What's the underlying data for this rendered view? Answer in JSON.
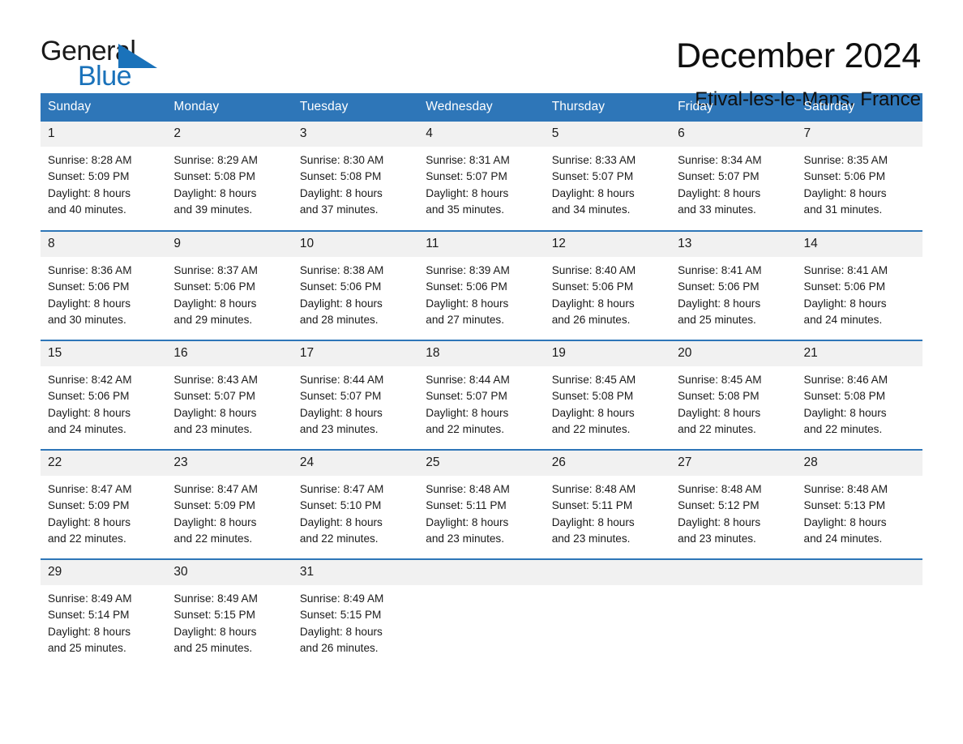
{
  "brand": {
    "name_part1": "General",
    "name_part2": "Blue",
    "accent_color": "#1a72ba"
  },
  "header": {
    "title": "December 2024",
    "location": "Etival-les-le-Mans, France"
  },
  "theme": {
    "header_blue": "#2e76b8",
    "day_band_gray": "#f1f1f1",
    "text_color": "#1a1a1a"
  },
  "calendar": {
    "weekday_headers": [
      "Sunday",
      "Monday",
      "Tuesday",
      "Wednesday",
      "Thursday",
      "Friday",
      "Saturday"
    ],
    "weeks": [
      [
        {
          "day": "1",
          "info": "Sunrise: 8:28 AM\nSunset: 5:09 PM\nDaylight: 8 hours\nand 40 minutes."
        },
        {
          "day": "2",
          "info": "Sunrise: 8:29 AM\nSunset: 5:08 PM\nDaylight: 8 hours\nand 39 minutes."
        },
        {
          "day": "3",
          "info": "Sunrise: 8:30 AM\nSunset: 5:08 PM\nDaylight: 8 hours\nand 37 minutes."
        },
        {
          "day": "4",
          "info": "Sunrise: 8:31 AM\nSunset: 5:07 PM\nDaylight: 8 hours\nand 35 minutes."
        },
        {
          "day": "5",
          "info": "Sunrise: 8:33 AM\nSunset: 5:07 PM\nDaylight: 8 hours\nand 34 minutes."
        },
        {
          "day": "6",
          "info": "Sunrise: 8:34 AM\nSunset: 5:07 PM\nDaylight: 8 hours\nand 33 minutes."
        },
        {
          "day": "7",
          "info": "Sunrise: 8:35 AM\nSunset: 5:06 PM\nDaylight: 8 hours\nand 31 minutes."
        }
      ],
      [
        {
          "day": "8",
          "info": "Sunrise: 8:36 AM\nSunset: 5:06 PM\nDaylight: 8 hours\nand 30 minutes."
        },
        {
          "day": "9",
          "info": "Sunrise: 8:37 AM\nSunset: 5:06 PM\nDaylight: 8 hours\nand 29 minutes."
        },
        {
          "day": "10",
          "info": "Sunrise: 8:38 AM\nSunset: 5:06 PM\nDaylight: 8 hours\nand 28 minutes."
        },
        {
          "day": "11",
          "info": "Sunrise: 8:39 AM\nSunset: 5:06 PM\nDaylight: 8 hours\nand 27 minutes."
        },
        {
          "day": "12",
          "info": "Sunrise: 8:40 AM\nSunset: 5:06 PM\nDaylight: 8 hours\nand 26 minutes."
        },
        {
          "day": "13",
          "info": "Sunrise: 8:41 AM\nSunset: 5:06 PM\nDaylight: 8 hours\nand 25 minutes."
        },
        {
          "day": "14",
          "info": "Sunrise: 8:41 AM\nSunset: 5:06 PM\nDaylight: 8 hours\nand 24 minutes."
        }
      ],
      [
        {
          "day": "15",
          "info": "Sunrise: 8:42 AM\nSunset: 5:06 PM\nDaylight: 8 hours\nand 24 minutes."
        },
        {
          "day": "16",
          "info": "Sunrise: 8:43 AM\nSunset: 5:07 PM\nDaylight: 8 hours\nand 23 minutes."
        },
        {
          "day": "17",
          "info": "Sunrise: 8:44 AM\nSunset: 5:07 PM\nDaylight: 8 hours\nand 23 minutes."
        },
        {
          "day": "18",
          "info": "Sunrise: 8:44 AM\nSunset: 5:07 PM\nDaylight: 8 hours\nand 22 minutes."
        },
        {
          "day": "19",
          "info": "Sunrise: 8:45 AM\nSunset: 5:08 PM\nDaylight: 8 hours\nand 22 minutes."
        },
        {
          "day": "20",
          "info": "Sunrise: 8:45 AM\nSunset: 5:08 PM\nDaylight: 8 hours\nand 22 minutes."
        },
        {
          "day": "21",
          "info": "Sunrise: 8:46 AM\nSunset: 5:08 PM\nDaylight: 8 hours\nand 22 minutes."
        }
      ],
      [
        {
          "day": "22",
          "info": "Sunrise: 8:47 AM\nSunset: 5:09 PM\nDaylight: 8 hours\nand 22 minutes."
        },
        {
          "day": "23",
          "info": "Sunrise: 8:47 AM\nSunset: 5:09 PM\nDaylight: 8 hours\nand 22 minutes."
        },
        {
          "day": "24",
          "info": "Sunrise: 8:47 AM\nSunset: 5:10 PM\nDaylight: 8 hours\nand 22 minutes."
        },
        {
          "day": "25",
          "info": "Sunrise: 8:48 AM\nSunset: 5:11 PM\nDaylight: 8 hours\nand 23 minutes."
        },
        {
          "day": "26",
          "info": "Sunrise: 8:48 AM\nSunset: 5:11 PM\nDaylight: 8 hours\nand 23 minutes."
        },
        {
          "day": "27",
          "info": "Sunrise: 8:48 AM\nSunset: 5:12 PM\nDaylight: 8 hours\nand 23 minutes."
        },
        {
          "day": "28",
          "info": "Sunrise: 8:48 AM\nSunset: 5:13 PM\nDaylight: 8 hours\nand 24 minutes."
        }
      ],
      [
        {
          "day": "29",
          "info": "Sunrise: 8:49 AM\nSunset: 5:14 PM\nDaylight: 8 hours\nand 25 minutes."
        },
        {
          "day": "30",
          "info": "Sunrise: 8:49 AM\nSunset: 5:15 PM\nDaylight: 8 hours\nand 25 minutes."
        },
        {
          "day": "31",
          "info": "Sunrise: 8:49 AM\nSunset: 5:15 PM\nDaylight: 8 hours\nand 26 minutes."
        },
        {
          "day": "",
          "info": ""
        },
        {
          "day": "",
          "info": ""
        },
        {
          "day": "",
          "info": ""
        },
        {
          "day": "",
          "info": ""
        }
      ]
    ]
  }
}
